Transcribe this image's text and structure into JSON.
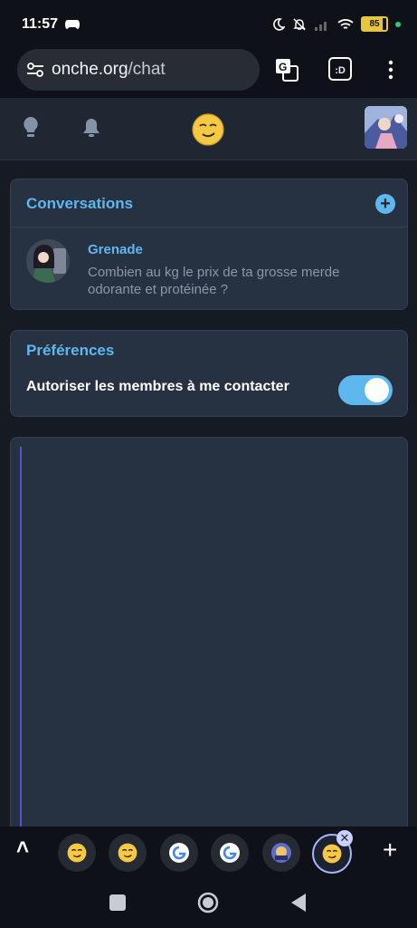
{
  "status_bar": {
    "time": "11:57",
    "battery": "85"
  },
  "browser": {
    "url_domain": "onche.org",
    "url_path": "/chat",
    "extra_icon_label": ":D"
  },
  "conversations": {
    "title": "Conversations",
    "add_label": "+",
    "items": [
      {
        "name": "Grenade",
        "preview": "Combien au kg le prix de ta grosse merde odorante et protéinée ?"
      }
    ]
  },
  "preferences": {
    "title": "Préférences",
    "allow_contact_label": "Autoriser les membres à me contacter",
    "allow_contact_enabled": true
  },
  "tabs": {
    "close_label": "✕",
    "add_label": "+",
    "up_label": "˄"
  },
  "colors": {
    "accent": "#5fb7f0",
    "card": "#263142",
    "background": "#161b23",
    "thread_line": "#5b4fd6"
  }
}
